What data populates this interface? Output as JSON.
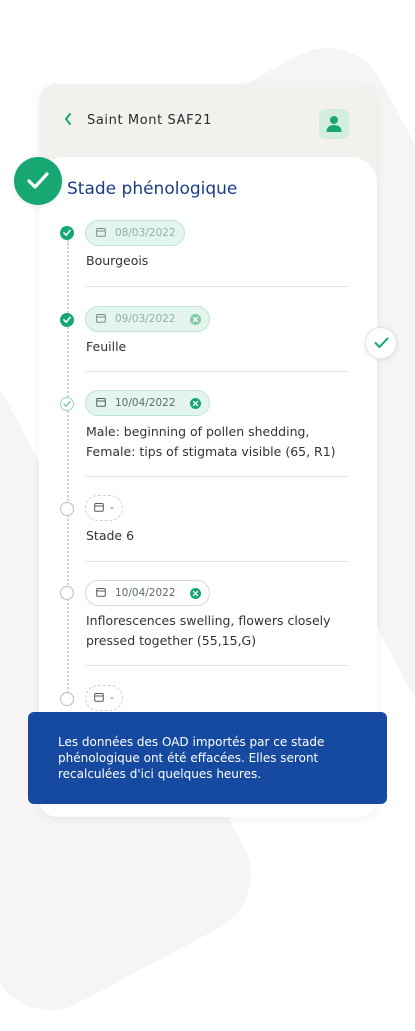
{
  "header": {
    "title": "Saint Mont SAF21",
    "back_icon": "chevron-left-icon",
    "profile_icon": "person-icon"
  },
  "section": {
    "title": "Stade phénologique"
  },
  "stages": [
    {
      "date": "08/03/2022",
      "name": "Bourgeois",
      "status": "done"
    },
    {
      "date": "09/03/2022",
      "name": "Feuille",
      "status": "done"
    },
    {
      "date": "10/04/2022",
      "name": "Male: beginning of pollen shedding, Female: tips of stigmata visible (65, R1)",
      "status": "light"
    },
    {
      "date": "-",
      "name": "Stade 6",
      "status": "empty"
    },
    {
      "date": "10/04/2022",
      "name": "Inflorescences swelling, flowers closely pressed together (55,15,G)",
      "status": "empty"
    },
    {
      "date": "-",
      "name": "",
      "status": "empty"
    }
  ],
  "snackbar": {
    "message": "Les données des OAD importés par ce stade phénologique ont été effacées. Elles seront recalculées d'ici quelques heures."
  },
  "colors": {
    "accent_green": "#16a772",
    "title_blue": "#1b3c86",
    "snackbar_blue": "#164aa0"
  }
}
